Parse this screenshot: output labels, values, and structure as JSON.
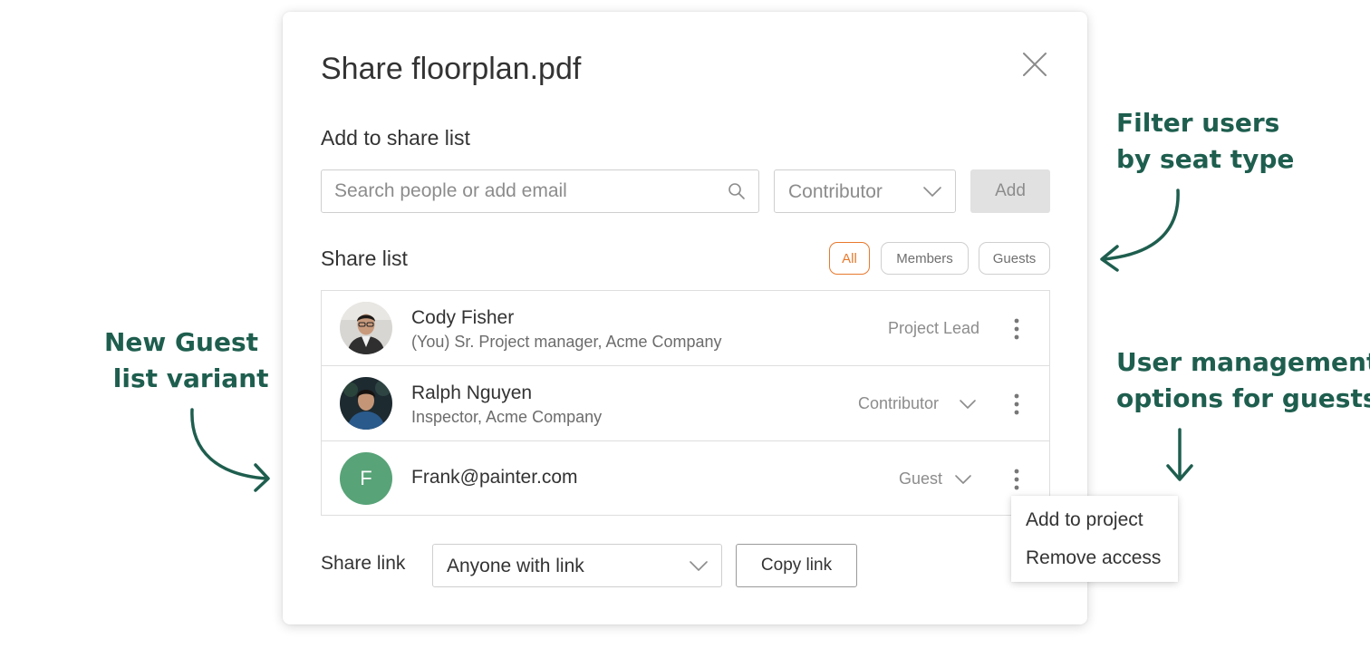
{
  "modal": {
    "title": "Share floorplan.pdf",
    "add_section_label": "Add to share list",
    "search": {
      "placeholder": "Search people or add email",
      "value": ""
    },
    "role_select": {
      "value": "Contributor"
    },
    "add_button": "Add",
    "share_list_label": "Share list",
    "filters": [
      {
        "label": "All",
        "active": true
      },
      {
        "label": "Members",
        "active": false
      },
      {
        "label": "Guests",
        "active": false
      }
    ],
    "users": [
      {
        "name": "Cody Fisher",
        "subtitle": "(You) Sr. Project manager, Acme Company",
        "role": "Project Lead",
        "role_editable": false,
        "avatar": "photo"
      },
      {
        "name": "Ralph Nguyen",
        "subtitle": "Inspector, Acme Company",
        "role": "Contributor",
        "role_editable": true,
        "avatar": "photo"
      },
      {
        "name": "Frank@painter.com",
        "subtitle": "",
        "role": "Guest",
        "role_editable": true,
        "avatar": "F"
      }
    ],
    "share_link_label": "Share link",
    "share_link_select": "Anyone with link",
    "copy_link_button": "Copy link"
  },
  "menu": {
    "items": [
      "Add to project",
      "Remove access"
    ]
  },
  "annotations": {
    "filter": "Filter users\nby seat type",
    "guest_variant": "New Guest\n list variant",
    "management": "User management\noptions for guests"
  },
  "colors": {
    "accent_orange": "#e8792d",
    "annotation_green": "#1e5e4e",
    "guest_avatar": "#58a378"
  },
  "icons": [
    "close-icon",
    "search-icon",
    "chevron-down-icon",
    "more-vertical-icon"
  ]
}
